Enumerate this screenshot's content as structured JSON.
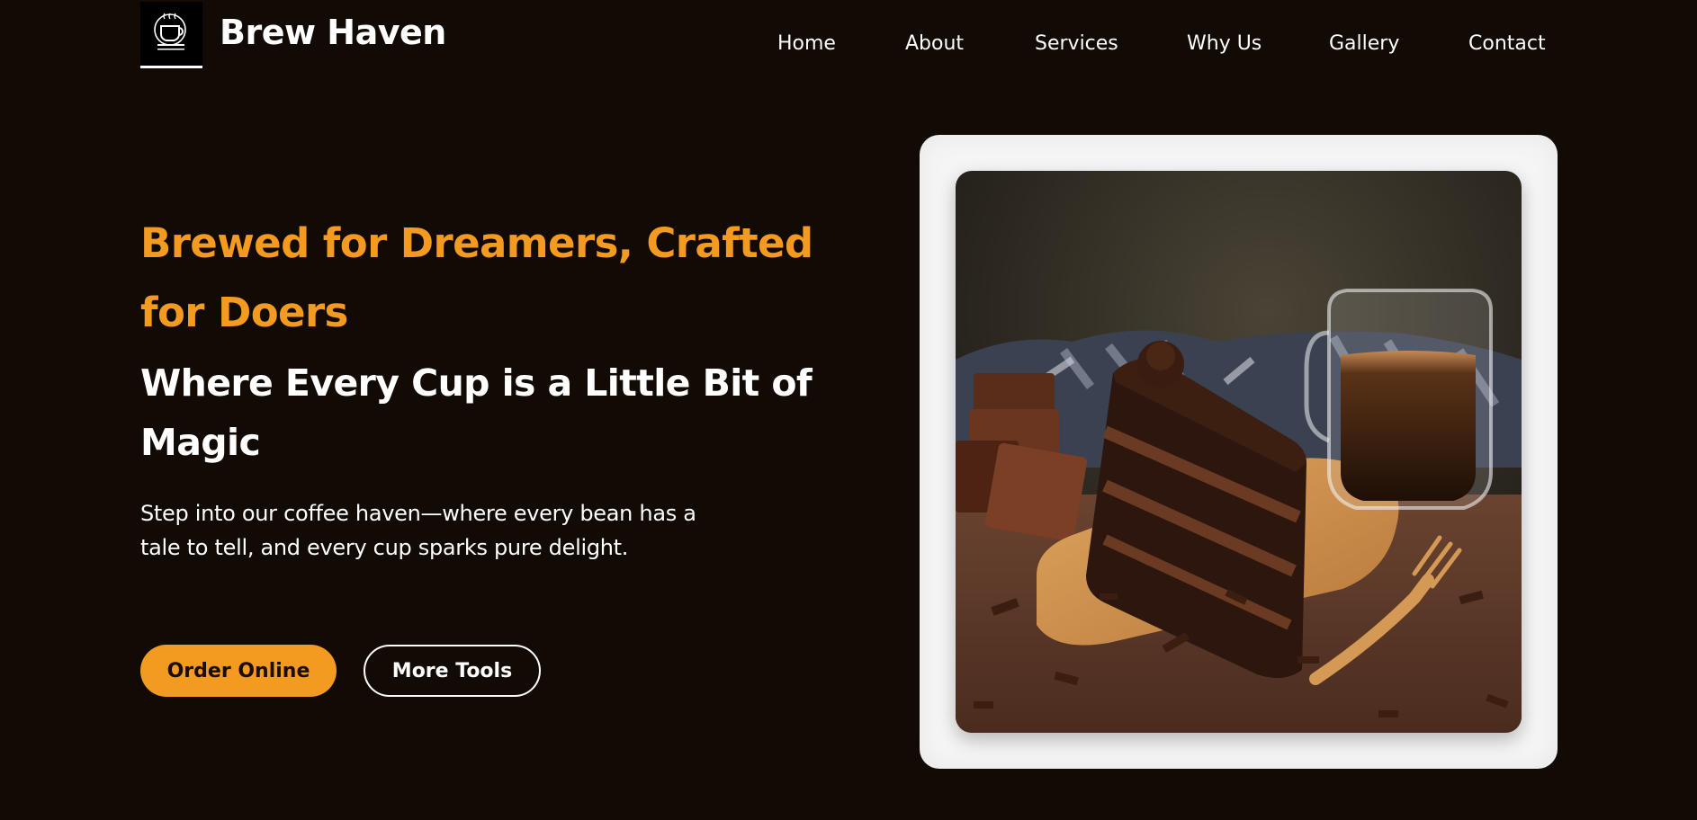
{
  "header": {
    "brand": "Brew Haven",
    "logo_icon": "coffee-cup-icon",
    "nav": [
      "Home",
      "About",
      "Services",
      "Why Us",
      "Gallery",
      "Contact"
    ]
  },
  "hero": {
    "title": "Brewed for Dreamers, Crafted for Doers",
    "subtitle": "Where Every Cup is a Little Bit of Magic",
    "description": "Step into our coffee haven—where every bean has a tale to tell, and every cup sparks pure delight.",
    "primary_button": "Order Online",
    "secondary_button": "More Tools"
  },
  "colors": {
    "background": "#120a05",
    "accent": "#f39a21",
    "text": "#ffffff"
  }
}
